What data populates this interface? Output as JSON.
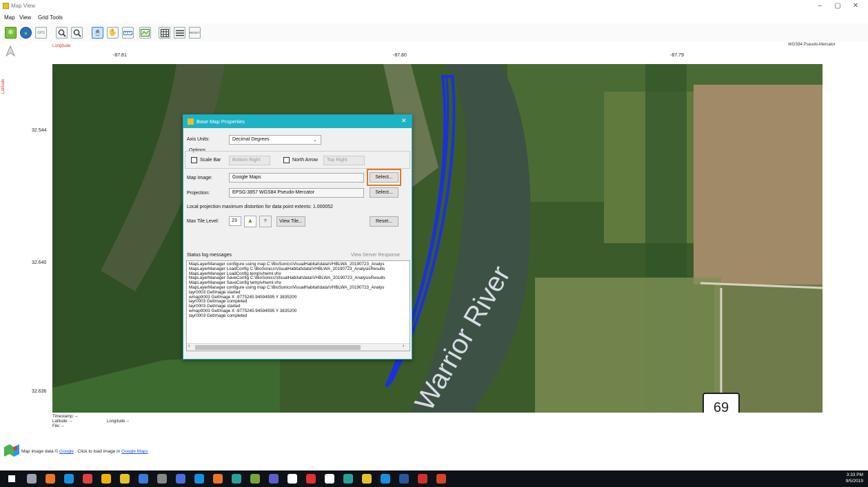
{
  "window": {
    "title": "Map View"
  },
  "menu": [
    "Map",
    "View",
    "Grid Tools"
  ],
  "toolbar": {
    "icons": [
      "gear-icon",
      "globe-icon",
      "gps-icon",
      "zoom-in-icon",
      "zoom-out-icon",
      "select-icon",
      "pan-hand-icon",
      "ruler-icon",
      "map-export-icon",
      "grid-icon",
      "list-icon",
      "reset-icon"
    ],
    "gps_label": "GPS",
    "reset_label": "RESET"
  },
  "axes": {
    "x_label": "Longitude",
    "y_label": "Latitude",
    "projection": "WGS84 Pseudo-Mercator",
    "x_ticks": [
      "-87.81",
      "-87.80",
      "-87.79"
    ],
    "y_ticks": [
      "32.544",
      "32.640",
      "32.636"
    ]
  },
  "map": {
    "river_label": "Warrior River",
    "road_sign": "69"
  },
  "dialog": {
    "title": "Base Map Properties",
    "axis_units_label": "Axis Units:",
    "axis_units_value": "Decimal Degrees",
    "options_label": "Options",
    "scale_bar_label": "Scale Bar",
    "scale_bar_position": "Bottom Right",
    "north_arrow_label": "North Arrow",
    "north_arrow_position": "Top Right",
    "map_image_label": "Map Image:",
    "map_image_value": "Google Maps",
    "select_label": "Select...",
    "projection_label": "Projection:",
    "projection_value": "EPSG:3857 WGS84 Pseudo-Mercator",
    "distortion_text": "Local projection maximum distortion for data point extents: 1.000052",
    "max_tile_label": "Max Tile Level:",
    "max_tile_value": "23",
    "view_tile_label": "View Tile...",
    "reset_label": "Reset...",
    "status_log_label": "Status log messages",
    "view_server_response": "View Server Response",
    "log": [
      "MapLayerManager configure using map C:\\BioSonics\\VisualHabitat\\data\\VHBLWA_20190723_Analys",
      "MapLayerManager LoadConfig C:\\BioSonics\\VisualHabitat\\data\\VHBLWA_20190723_AnalysisResults",
      "MapLayerManager LoadConfig temp\\vhwml.vhx",
      "MapLayerManager SaveConfig C:\\BioSonics\\VisualHabitat\\data\\VHBLWA_20190723_AnalysisResults",
      "MapLayerManager SaveConfig temp\\vhwml.vhx",
      "MapLayerManager configure using map C:\\BioSonics\\VisualHabitat\\data\\VHBLWA_20190723_Analys",
      "layr0003 GetImage started",
      "wmap0003 GetImage X -9775245.94594595 Y 3835200",
      "layr0003 GetImage completed",
      "layr0003 GetImage started",
      "wmap0003 GetImage X -9775245.94594595 Y 3835200",
      "layr0003 GetImage completed"
    ]
  },
  "status": {
    "timestamp": "Timestamp: --",
    "latitude": "Latitude: --",
    "longitude": "Longitude --",
    "file": "File: --"
  },
  "footer": {
    "prefix": "Map image data ©",
    "google_link": "Google",
    "middle": ". Click to load image in",
    "maps_link": "Google Maps"
  },
  "taskbar": {
    "time": "3:33 PM",
    "date": "9/5/2019",
    "apps": [
      "windows-start-icon",
      "task-view-icon",
      "firefox-icon",
      "edge-icon",
      "vivaldi-icon",
      "chrome-icon",
      "file-explorer-icon",
      "people-icon",
      "calculator-icon",
      "app-icon",
      "ie-icon",
      "firefox-dev-icon",
      "app-icon",
      "vhabitat-icon",
      "app-icon",
      "app-icon",
      "app-icon",
      "app-icon",
      "app-icon",
      "map-view-icon",
      "app-icon",
      "word-icon",
      "acrobat-icon",
      "powerpoint-icon"
    ],
    "app_colors": [
      "#ffffff",
      "#9aa4b0",
      "#e8762b",
      "#1a8fe0",
      "#e04040",
      "#f0b400",
      "#e6c12a",
      "#3a7bd5",
      "#888888",
      "#4a6ee0",
      "#1a8fe0",
      "#e8762b",
      "#2aa198",
      "#7aa53a",
      "#5b5fc7",
      "#ffffff",
      "#e03030",
      "#ffffff",
      "#2aa198",
      "#e6c12a",
      "#1a8fe0",
      "#2b579a",
      "#d03030",
      "#d24726"
    ]
  }
}
